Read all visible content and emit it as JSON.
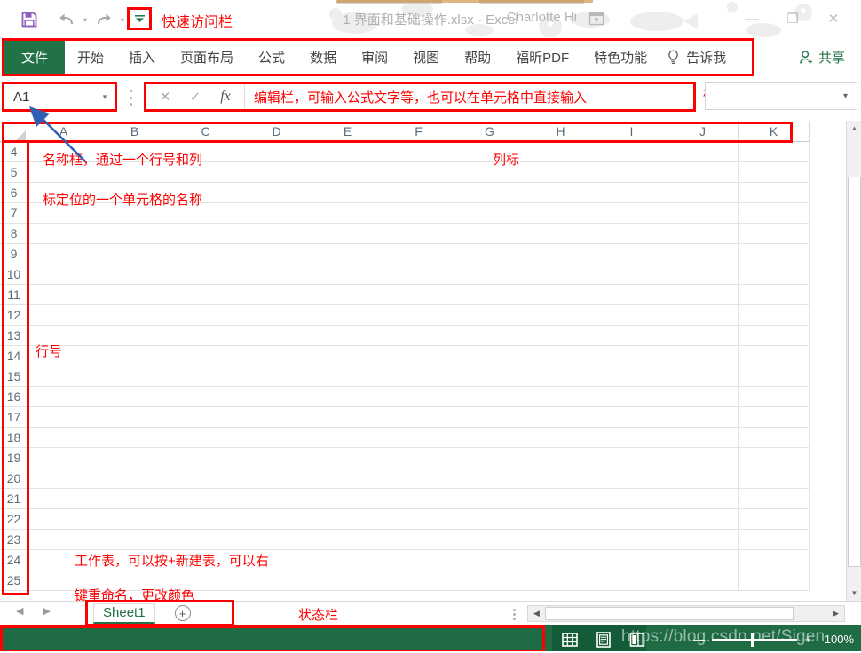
{
  "window": {
    "title": "1 界面和基础操作.xlsx  -  Excel",
    "account": "Charlotte Hi",
    "minimize_label": "—",
    "maximize_label": "❐",
    "close_label": "✕",
    "ribbon_display_options": "ribbon-display-options-icon"
  },
  "quick_access": {
    "save_label": "save-icon",
    "undo_label": "undo-icon",
    "redo_label": "redo-icon",
    "customize_label": "▾",
    "annotation": "快速访问栏"
  },
  "ribbon": {
    "file_tab": "文件",
    "tabs": [
      "开始",
      "插入",
      "页面布局",
      "公式",
      "数据",
      "审阅",
      "视图",
      "帮助",
      "福昕PDF",
      "特色功能"
    ],
    "tell_me": "告诉我",
    "tell_me_icon": "lightbulb-icon",
    "share": "共享",
    "share_icon": "share-person-icon"
  },
  "formula_bar": {
    "name_box_value": "A1",
    "name_box_caret": "▾",
    "cancel_icon": "✕",
    "confirm_icon": "✓",
    "fx_icon": "fx",
    "content": "编辑栏，可输入公式文字等，也可以在单元格中直接输入",
    "expand_caret": "▾",
    "tagbar_annotation": "标签栏"
  },
  "grid": {
    "columns": [
      "A",
      "B",
      "C",
      "D",
      "E",
      "F",
      "G",
      "H",
      "I",
      "J",
      "K"
    ],
    "rows": [
      4,
      5,
      6,
      7,
      8,
      9,
      10,
      11,
      12,
      13,
      14,
      15,
      16,
      17,
      18,
      19,
      20,
      21,
      22,
      23,
      24,
      25
    ],
    "annotations": {
      "name_box_line1": "名称框，通过一个行号和列",
      "name_box_line2": "标定位的一个单元格的名称",
      "column_header": "列标",
      "row_number": "行号",
      "sheet_line1": "工作表，可以按+新建表，可以右",
      "sheet_line2": "键重命名，更改颜色"
    }
  },
  "sheet_bar": {
    "prev_icon": "◀",
    "next_icon": "▶",
    "tabs": [
      "Sheet1"
    ],
    "add_sheet": "+",
    "status_annotation": "状态栏",
    "hscroll_left": "◀",
    "hscroll_right": "▶"
  },
  "status_bar": {
    "views": [
      "normal-view-icon",
      "page-layout-icon",
      "page-break-icon"
    ],
    "zoom_out": "—",
    "zoom_in": "+",
    "zoom_level": "100%",
    "watermark": "https://blog.csdn.net/Sigen"
  },
  "colors": {
    "excel_green": "#217346",
    "status_green": "#1e6b44",
    "annotation_red": "#ff0000",
    "arrow_blue": "#2f5fb3"
  }
}
